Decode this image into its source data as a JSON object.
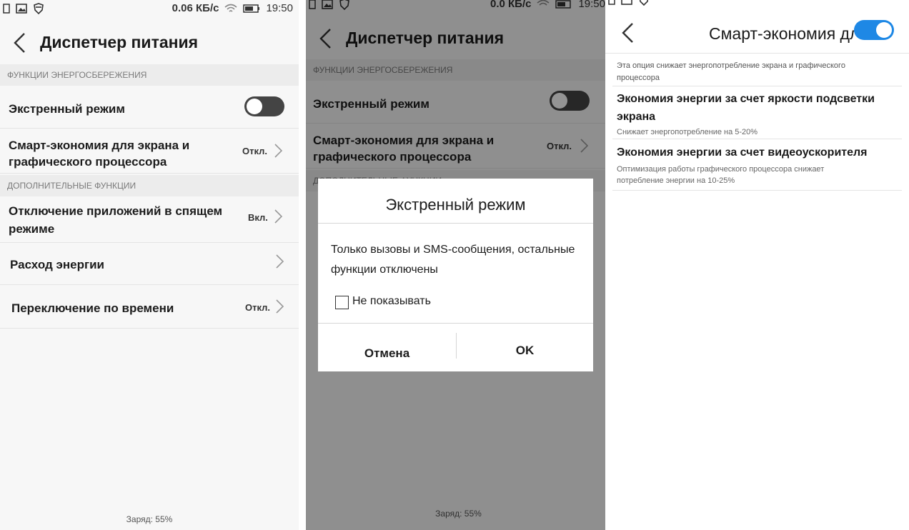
{
  "colors": {
    "accent": "#1e88e5",
    "toggle_off": "#444444"
  },
  "panel1": {
    "status": {
      "speed": "0.06 КБ/с",
      "time": "19:50"
    },
    "title": "Диспетчер питания",
    "section1": "ФУНКЦИИ ЭНЕРГОСБЕРЕЖЕНИЯ",
    "emergency_label": "Экстренный режим",
    "smart_label_1": "Смарт-экономия для экрана и",
    "smart_label_2": "графического процессора",
    "smart_value": "Откл.",
    "section2": "ДОПОЛНИТЕЛЬНЫЕ ФУНКЦИИ",
    "sleep_label_1": "Отключение приложений в спящем",
    "sleep_label_2": "режиме",
    "sleep_value": "Вкл.",
    "usage_label": "Расход энергии",
    "schedule_label": "Переключение по времени",
    "schedule_value": "Откл.",
    "charge": "Заряд: 55%"
  },
  "panel2": {
    "status": {
      "speed": "0.0 КБ/с",
      "time": "19:50"
    },
    "title": "Диспетчер питания",
    "section1": "ФУНКЦИИ ЭНЕРГОСБЕРЕЖЕНИЯ",
    "emergency_label": "Экстренный режим",
    "smart_label_1": "Смарт-экономия для экрана и",
    "smart_label_2": "графического процессора",
    "smart_value": "Откл.",
    "section2": "ДОПОЛНИТЕЛЬНЫЕ ФУНКЦИИ",
    "charge": "Заряд: 55%",
    "dialog": {
      "title": "Экстренный режим",
      "message_1": "Только вызовы и SMS-сообщения, остальные",
      "message_2": "функции отключены",
      "checkbox_label": "Не показывать",
      "cancel": "Отмена",
      "ok": "OK"
    }
  },
  "panel3": {
    "title": "Смарт-экономия для",
    "description_1": "Эта опция снижает энергопотребление экрана и графического",
    "description_2": "процессора",
    "item1_title_1": "Экономия энергии за счет яркости подсветки",
    "item1_title_2": "экрана",
    "item1_sub": "Снижает энергопотребление на 5-20%",
    "item2_title": "Экономия энергии за счет видеоускорителя",
    "item2_sub_1": "Оптимизация работы графического процессора снижает",
    "item2_sub_2": "потребление энергии на 10-25%"
  }
}
